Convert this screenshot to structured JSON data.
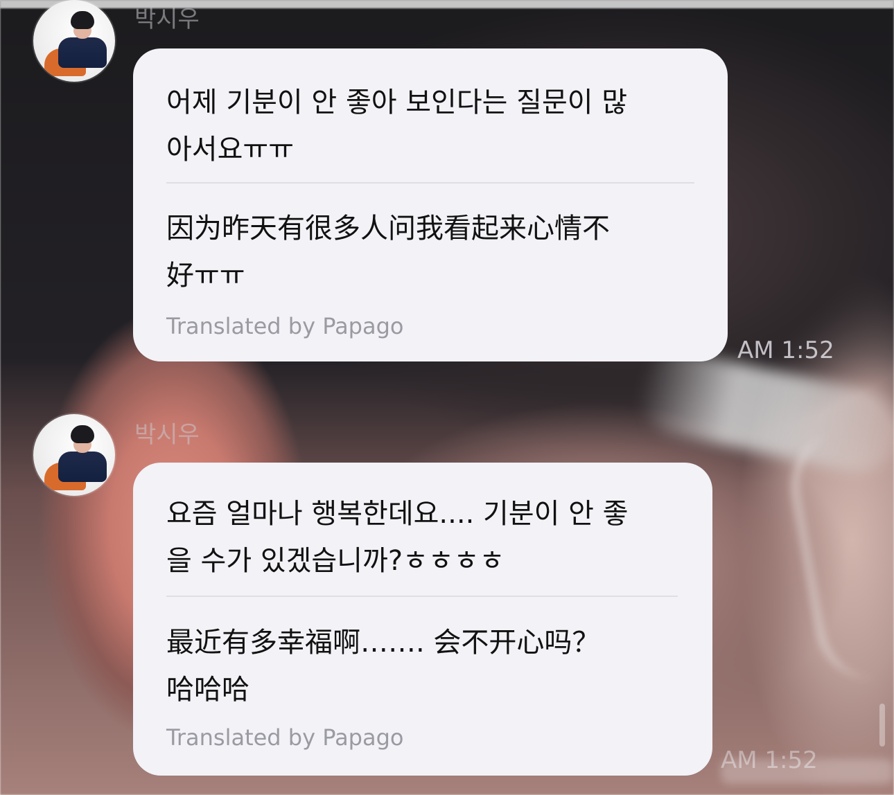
{
  "chat": {
    "messages": [
      {
        "sender": "박시우",
        "original": "어제 기분이 안 좋아 보인다는 질문이 많\n아서요ㅠㅠ",
        "translation": "因为昨天有很多人问我看起来心情不\n好ㅠㅠ",
        "translated_by": "Translated by Papago",
        "time": "AM 1:52"
      },
      {
        "sender": "박시우",
        "original": "요즘 얼마나 행복한데요.... 기분이 안 좋\n을 수가 있겠습니까?ㅎㅎㅎㅎ",
        "translation": "最近有多幸福啊……. 会不开心吗？\n哈哈哈",
        "translated_by": "Translated by Papago",
        "time": "AM 1:52"
      }
    ]
  },
  "colors": {
    "bubble_bg": "#f2f2f7",
    "text_primary": "#111111",
    "text_secondary": "#9a9aa2",
    "timestamp": "#ebebf0"
  },
  "icons": {
    "avatar": "profile-avatar"
  }
}
